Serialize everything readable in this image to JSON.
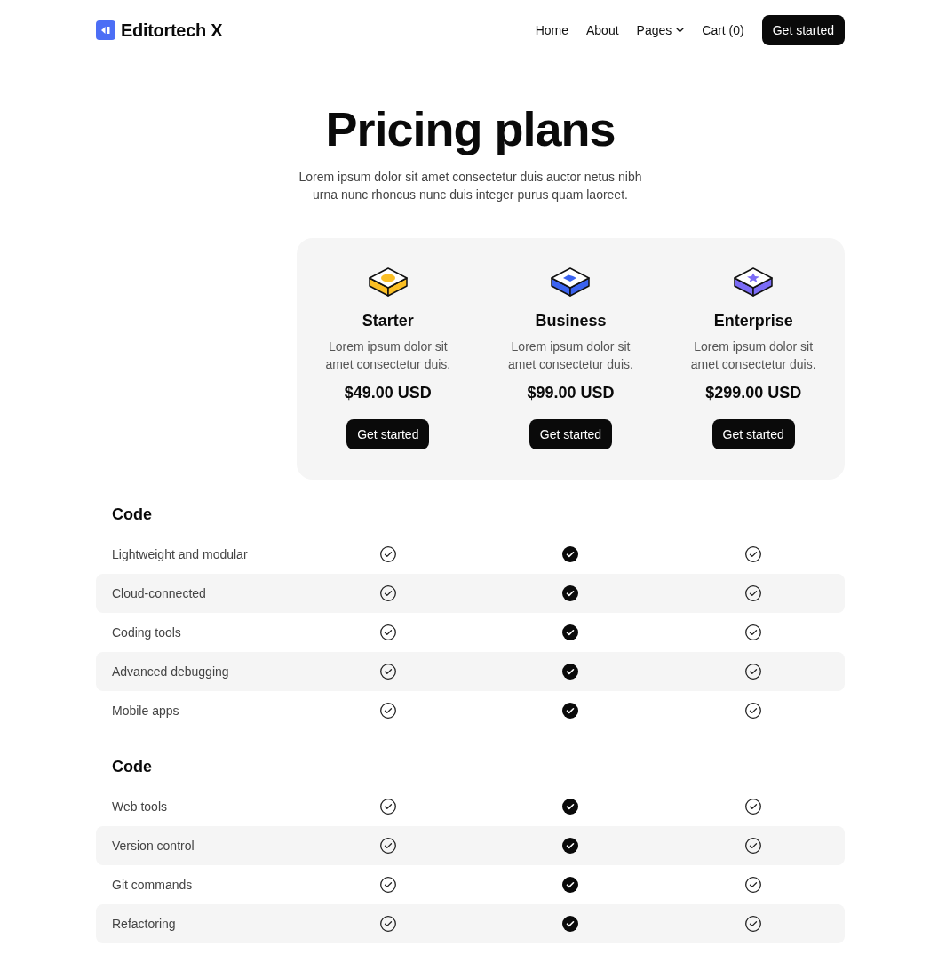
{
  "header": {
    "logo": {
      "text": "Editortech X"
    },
    "nav": [
      {
        "label": "Home",
        "dropdown": false
      },
      {
        "label": "About",
        "dropdown": false
      },
      {
        "label": "Pages",
        "dropdown": true
      },
      {
        "label": "Cart (0)",
        "dropdown": false
      }
    ],
    "cta": "Get started"
  },
  "hero": {
    "title": "Pricing plans",
    "subtitle": "Lorem ipsum dolor sit amet consectetur duis auctor netus nibh urna nunc rhoncus nunc duis integer purus quam laoreet."
  },
  "plans": [
    {
      "name": "Starter",
      "color": "#fbbf24",
      "description": "Lorem ipsum dolor sit amet consectetur duis.",
      "price": "$49.00 USD",
      "button": "Get started",
      "highlighted": false
    },
    {
      "name": "Business",
      "color": "#3b63f0",
      "description": "Lorem ipsum dolor sit amet consectetur duis.",
      "price": "$99.00 USD",
      "button": "Get started",
      "highlighted": true
    },
    {
      "name": "Enterprise",
      "color": "#7b6cf6",
      "description": "Lorem ipsum dolor sit amet consectetur duis.",
      "price": "$299.00 USD",
      "button": "Get started",
      "highlighted": false
    }
  ],
  "sections": [
    {
      "title": "Code",
      "features": [
        {
          "label": "Lightweight and modular",
          "included": [
            true,
            true,
            true
          ]
        },
        {
          "label": "Cloud-connected",
          "included": [
            true,
            true,
            true
          ]
        },
        {
          "label": "Coding tools",
          "included": [
            true,
            true,
            true
          ]
        },
        {
          "label": "Advanced debugging",
          "included": [
            true,
            true,
            true
          ]
        },
        {
          "label": "Mobile apps",
          "included": [
            true,
            true,
            true
          ]
        }
      ]
    },
    {
      "title": "Code",
      "features": [
        {
          "label": "Web tools",
          "included": [
            true,
            true,
            true
          ]
        },
        {
          "label": "Version control",
          "included": [
            true,
            true,
            true
          ]
        },
        {
          "label": "Git commands",
          "included": [
            true,
            true,
            true
          ]
        },
        {
          "label": "Refactoring",
          "included": [
            true,
            true,
            true
          ]
        }
      ]
    }
  ]
}
